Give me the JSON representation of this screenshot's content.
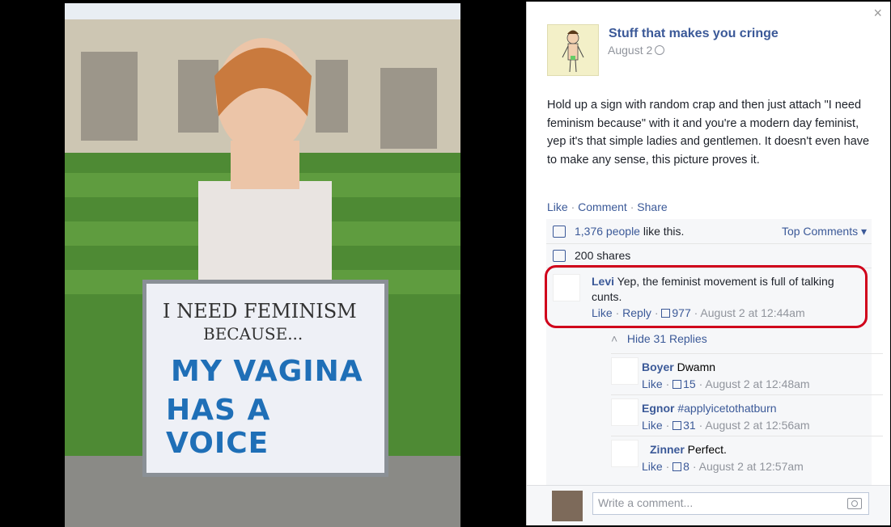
{
  "close_label": "×",
  "post": {
    "page_name": "Stuff that makes you cringe",
    "date": "August 2",
    "text": "Hold up a sign with random crap and then just attach \"I need feminism because\" with it and you're a modern day feminist, yep it's that simple ladies and gentlemen. It doesn't even have to make any sense, this picture proves it.",
    "actions": [
      "Like",
      "Comment",
      "Share"
    ]
  },
  "ufi": {
    "likes_count": "1,376 people",
    "likes_suffix": " like this.",
    "top_comments": "Top Comments ▾",
    "shares": "200 shares"
  },
  "main_comment": {
    "author": "Levi",
    "text": " Yep, the feminist movement is full of talking cunts.",
    "like": "Like",
    "reply": "Reply",
    "likes": "977",
    "time": "August 2 at 12:44am"
  },
  "hide_replies": "Hide 31 Replies",
  "replies": [
    {
      "author": "Boyer",
      "text": " Dwamn",
      "likes": "15",
      "time": "August 2 at 12:48am"
    },
    {
      "author": "Egnor",
      "text": " #applyicetothatburn",
      "likes": "31",
      "time": "August 2 at 12:56am"
    },
    {
      "author": "Zinner",
      "text": " Perfect.",
      "likes": "8",
      "time": "August 2 at 12:57am"
    }
  ],
  "reply_like": "Like",
  "write_placeholder": "Write a comment...",
  "sign": {
    "line1": "I NEED FEMINISM",
    "line2": "BECAUSE...",
    "line3": "MY VAGINA",
    "line4": "HAS A VOICE"
  },
  "colors": {
    "link": "#3b5998",
    "highlight": "#d0021b"
  }
}
